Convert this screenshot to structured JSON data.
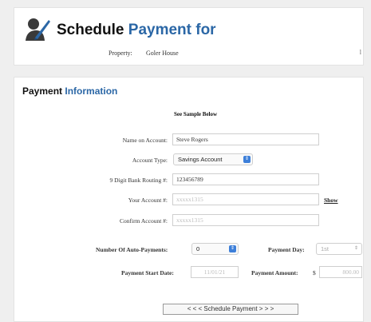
{
  "header": {
    "title_part1": "Schedule",
    "title_part2": "Payment for",
    "property_label": "Property:",
    "property_value": "Goler House",
    "edge_mark": "l"
  },
  "section": {
    "title_part1": "Payment",
    "title_part2": "Information",
    "sample_link": "See Sample Below"
  },
  "form": {
    "name_label": "Name on Account:",
    "name_value": "Steve Rogers",
    "type_label": "Account Type:",
    "type_value": "Savings Account",
    "routing_label": "9 Digit Bank Routing #:",
    "routing_value": "123456789",
    "account_label": "Your Account #:",
    "account_value": "xxxxx1315",
    "show_link": "Show",
    "confirm_label": "Confirm Account #:",
    "confirm_value": "xxxxx1315",
    "auto_label": "Number Of Auto-Payments:",
    "auto_value": "0",
    "day_label": "Payment Day:",
    "day_value": "1st",
    "start_label": "Payment Start Date:",
    "start_value": "11/01/21",
    "amount_label": "Payment Amount:",
    "currency": "$",
    "amount_value": "800.00",
    "submit_label": "< < <  Schedule Payment  > > >"
  },
  "colors": {
    "accent": "#2b67a6",
    "select_arrow": "#3d7fd9"
  }
}
